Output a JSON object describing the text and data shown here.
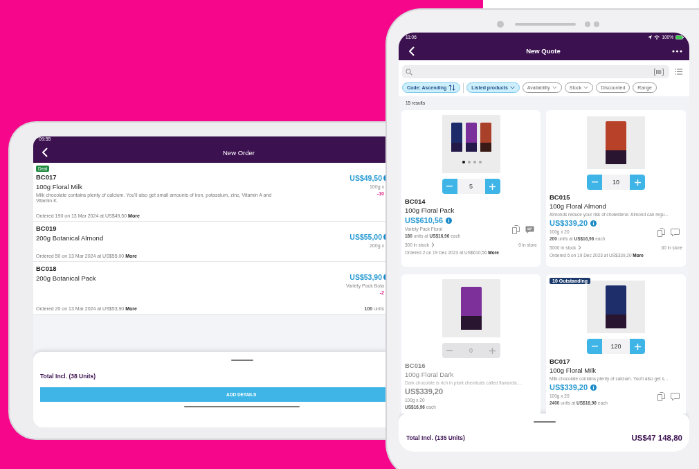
{
  "tablet": {
    "status_time": "09:55",
    "title": "New Order",
    "items": [
      {
        "badge": "Deal",
        "code": "BC017",
        "name": "100g Floral Milk",
        "description": "Milk chocolate contains plenty of calcium. You'll also get small amounts of iron, potassium, zinc, Vitamin A and Vitamin K.",
        "history": "Ordered 190 on 13 Mar 2024 at US$49,50",
        "more": "More",
        "price": "US$49,50",
        "lines": [
          {
            "kind": "detail",
            "text": "100g x"
          },
          {
            "kind": "discount",
            "text": "-10"
          }
        ]
      },
      {
        "code": "BC019",
        "name": "200g Botanical Almond",
        "history": "Ordered 50 on 13 Mar 2024 at US$55,00",
        "more": "More",
        "price": "US$55,00",
        "lines": [
          {
            "kind": "detail",
            "text": "200g x"
          }
        ]
      },
      {
        "code": "BC018",
        "name": "200g Botanical Pack",
        "history": "Ordered 20 on 13 Mar 2024 at US$53,90",
        "more": "More",
        "price": "US$53,90",
        "lines": [
          {
            "kind": "detail",
            "text": "Variety Pack Bota"
          },
          {
            "kind": "discount",
            "text": "-2"
          },
          {
            "kind": "units",
            "text": "**100** units"
          }
        ]
      }
    ],
    "total_label": "Total Incl. (38 Units)",
    "button": "ADD DETAILS"
  },
  "phone": {
    "status_time": "11:06",
    "battery": "100%",
    "title": "New Quote",
    "filters": [
      {
        "kind": "sort",
        "label": "Code: Ascending",
        "selected": true
      },
      {
        "kind": "dropdown",
        "label": "Listed products",
        "selected": true
      },
      {
        "kind": "dropdown",
        "label": "Availability",
        "selected": false
      },
      {
        "kind": "dropdown",
        "label": "Stock",
        "selected": false
      },
      {
        "kind": "plain",
        "label": "Discounted",
        "selected": false
      },
      {
        "kind": "plain",
        "label": "Range",
        "selected": false
      }
    ],
    "results": "15 results",
    "products": [
      {
        "image": {
          "kind": "pack"
        },
        "quantity": "5",
        "disabled": false,
        "code": "BC014",
        "name": "100g Floral Pack",
        "price": "US$610,56",
        "detail": "Variety Pack Floral",
        "units": "**180** units at **US$16,96** each",
        "has_note": true,
        "stock": "300 in stock",
        "store": "0 in store",
        "history": "Ordered 2 on 19 Dec 2023 at US$610,56",
        "more": "More"
      },
      {
        "image": {
          "kind": "bar",
          "color": "#b8412a"
        },
        "quantity": "10",
        "disabled": false,
        "code": "BC015",
        "name": "100g Floral Almond",
        "description": "Almonds reduce your risk of cholesterol. Almond can regu...",
        "price": "US$339,20",
        "detail": "100g x 20",
        "units": "**200** units at **US$16,96** each",
        "has_note": false,
        "stock": "5000 in stock",
        "store": "60 in store",
        "history": "Ordered 6 on 19 Dec 2023 at US$339,20",
        "more": "More"
      },
      {
        "image": {
          "kind": "bar",
          "color": "#7d2f9a"
        },
        "quantity": "0",
        "disabled": true,
        "code": "BC016",
        "name": "100g Floral Dark",
        "description": "Dark chocolate is rich in plant chemicals called flavanols....",
        "price": "US$339,20",
        "detail": "100g x 20",
        "units": "**US$16,96** each"
      },
      {
        "badge": "10 Outstanding",
        "image": {
          "kind": "bar",
          "color": "#1d2e6b"
        },
        "quantity": "120",
        "disabled": false,
        "code": "BC017",
        "name": "100g Floral Milk",
        "description": "Milk chocolate contains plenty of calcium. You'll also get s...",
        "price": "US$339,20",
        "detail": "100g x 20",
        "units": "**2400** units at **US$16,96** each",
        "has_note": false
      }
    ],
    "total_label": "Total Incl. (135 Units)",
    "total": "US$47 148,80"
  }
}
